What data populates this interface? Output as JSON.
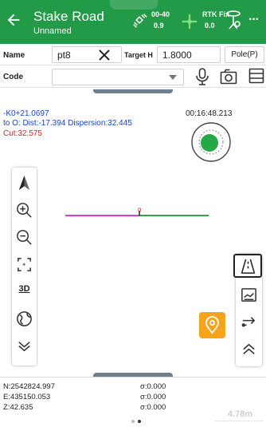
{
  "header": {
    "title": "Stake Road",
    "subtitle": "Unnamed",
    "satellites": "00-40",
    "satellites_sub": "0.9",
    "fix_status": "RTK Fix",
    "fix_value": "0.0",
    "more": "···"
  },
  "inputs": {
    "name_label": "Name",
    "name_value": "pt8",
    "target_h_label": "Target H",
    "target_h_value": "1.8000",
    "pole_label": "Pole(P)",
    "code_label": "Code",
    "code_value": ""
  },
  "stake": {
    "station": "-K0+21.0697",
    "distance": "to O: Dist:-17.394 Dispersion:32.445",
    "cut": "Cut:32.575",
    "timer": "00:16:48.213"
  },
  "map": {
    "origin_label": "o"
  },
  "left_toolbar": {
    "view_3d_label": "3D"
  },
  "coordinates": {
    "n": "N:2542824.997",
    "e": "E:435150.053",
    "z": "Z:42.635",
    "sigma_n": "σ:0.000",
    "sigma_e": "σ:0.000",
    "sigma_z": "σ:0.000",
    "scale": "4.78m"
  },
  "colors": {
    "header": "#239a48",
    "accent": "#f6a31c",
    "blue_text": "#1a3fd8",
    "red_text": "#ee1b1b",
    "line_pink": "#e33be4",
    "line_green": "#2ea84a"
  }
}
